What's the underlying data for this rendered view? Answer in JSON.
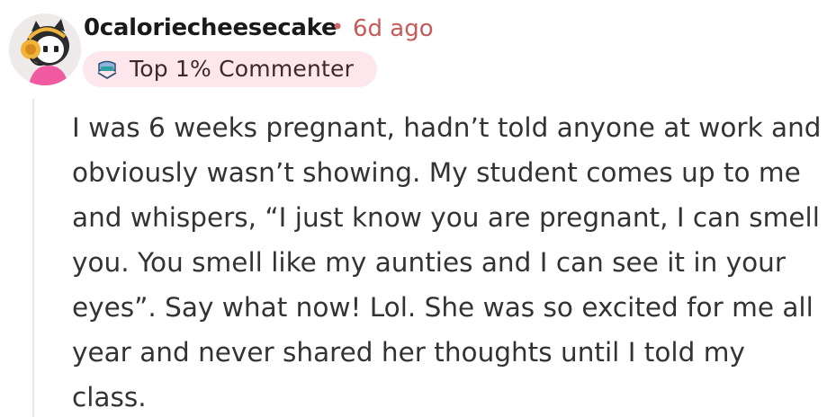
{
  "comment": {
    "username": "0caloriecheesecake",
    "separator": "•",
    "timestamp": "6d ago",
    "flair": {
      "label": "Top 1% Commenter",
      "icon": "commenter-badge-icon"
    },
    "avatar": "avatar-icon",
    "body": "I was 6 weeks pregnant, hadn’t told anyone at work and obviously wasn’t showing. My student comes up to me and whispers, “I just know you are pregnant, I can smell you. You smell like my aunties and I can see it in your eyes”. Say what now! Lol. She was so excited for me all year and never shared her thoughts until I told my class."
  },
  "colors": {
    "timestamp": "#c75a5a",
    "flair_background": "#fde7ec",
    "thread_line": "#f1e4e4",
    "body_text": "#333333"
  }
}
